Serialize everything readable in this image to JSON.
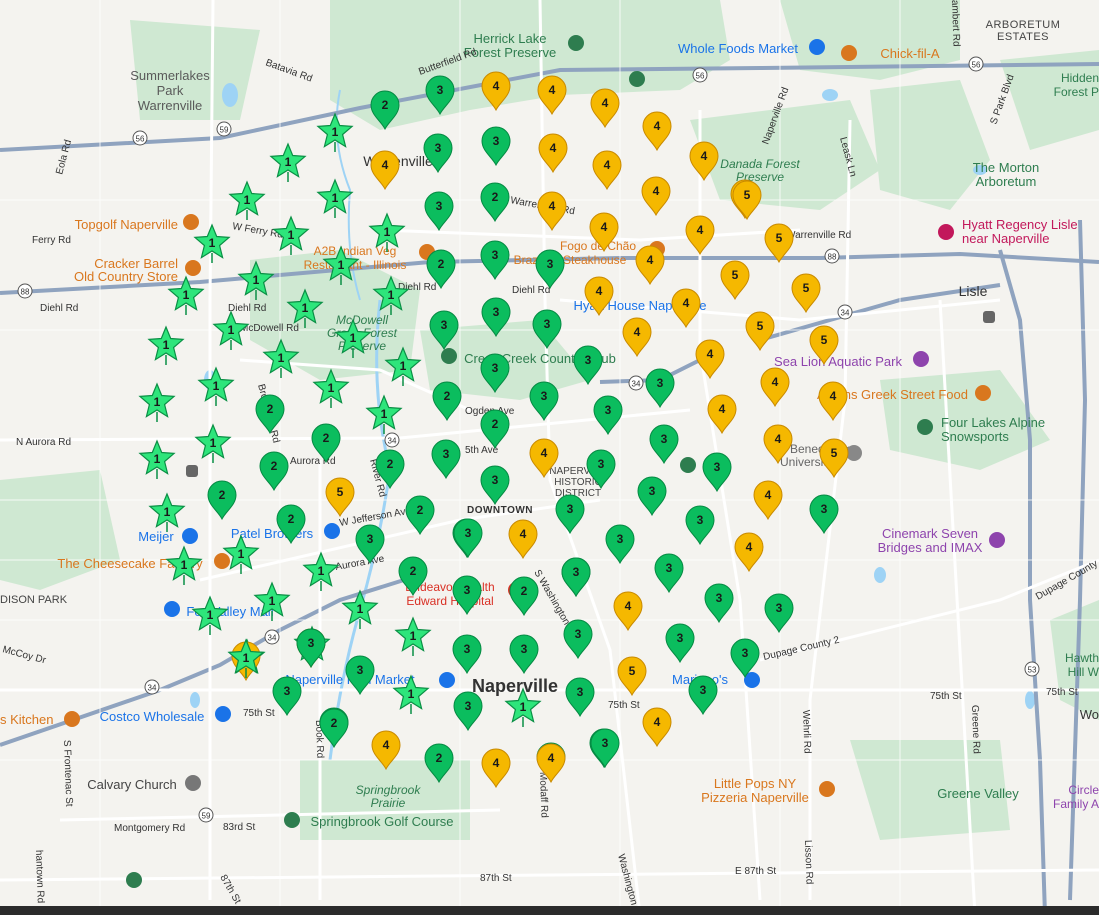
{
  "places": {
    "neighborhoods": {
      "summerlakes": "Summerlakes",
      "summerlakes_2": "Park",
      "summerlakes_3": "Warrenville",
      "arboretum": "ARBORETUM",
      "arboretum_2": "ESTATES",
      "historic": "NAPERVILLE",
      "historic_2": "HISTORIC",
      "historic_3": "DISTRICT",
      "downtown": "DOWNTOWN",
      "edison": "EDISON PARK"
    },
    "towns": {
      "naperville": "Naperville",
      "warrenville": "Warrenville",
      "lisle": "Lisle"
    },
    "pois": {
      "herrick": "Herrick Lake",
      "herrick_2": "Forest Preserve",
      "whole_foods": "Whole Foods Market",
      "chick": "Chick-fil-A",
      "hidden": "Hidden",
      "hidden_2": "Forest P",
      "danada": "Danada Forest",
      "danada_2": "Preserve",
      "morton": "The Morton",
      "morton_2": "Arboretum",
      "hyatt": "Hyatt Regency Lisle",
      "hyatt_2": "near Naperville",
      "topgolf": "Topgolf Naperville",
      "cracker": "Cracker Barrel",
      "cracker_2": "Old Country Store",
      "a2b": "A2B Indian Veg",
      "a2b_2": "Restaurant - Illinois",
      "fogo": "Fogo de Chão",
      "fogo_2": "Brazilian Steakhouse",
      "hyatt_house": "Hyatt House Naperville",
      "mcdowell": "McDowell",
      "mcdowell_2": "Grove Forest",
      "mcdowell_3": "Preserve",
      "country_club": "Cress Creek Country Club",
      "sealion": "Sea Lion Aquatic Park",
      "athens": "Athens Greek Street Food",
      "four_lakes": "Four Lakes Alpine",
      "four_lakes_2": "Snowsports",
      "benedictine": "Benedictine",
      "benedictine_2": "University",
      "meijer": "Meijer",
      "patel": "Patel Brothers",
      "cheesecake": "The Cheesecake Factory",
      "fox_valley": "Fox Valley Mall",
      "cinemark": "Cinemark Seven",
      "cinemark_2": "Bridges and IMAX",
      "edward": "Endeavor Health",
      "edward_2": "Edward Hospital",
      "fish": "Naperville Fish Market",
      "mariano": "Mariano's",
      "kitchen": "s Kitchen",
      "costco": "Costco Wholesale",
      "calvary": "Calvary Church",
      "springbrook": "Springbrook",
      "springbrook_2": "Prairie",
      "springbrook_golf": "Springbrook Golf Course",
      "little_pops": "Little Pops NY",
      "little_pops_2": "Pizzeria Naperville",
      "greene": "Greene Valley",
      "hawth": "Hawth",
      "hawth_2": "Hill W",
      "circle": "Circle",
      "circle_2": "Family A",
      "wo": "Wo"
    }
  },
  "roads": {
    "batavia": "Batavia Rd",
    "butterfield": "Butterfield Rd",
    "eola": "Eola Rd",
    "warrenville": "Warrenville Rd",
    "ferry": "Ferry Rd",
    "w_ferry": "W Ferry Rd",
    "diehl": "Diehl Rd",
    "diehl2": "Diehl Rd",
    "diehl3": "Diehl Rd",
    "mcdowell": "McDowell Rd",
    "brookdale": "Brookdale Rd",
    "n_aurora": "N Aurora Rd",
    "aurora_rd": "Aurora Rd",
    "aurora_ave": "Aurora Ave",
    "ogden": "Ogden Ave",
    "fifth": "5th Ave",
    "jefferson": "W Jefferson Ave",
    "river": "River Rd",
    "washington": "S Washington St",
    "modaff": "Modaff Rd",
    "dupage": "Dupage County 2",
    "dupage_county": "Dupage County",
    "w_75th": "75th St",
    "e_75th": "75th St",
    "e_75th_2": "75th St",
    "mccoy": "McCoy Dr",
    "montgomery": "Montgomery Rd",
    "st_83": "83rd St",
    "st_87": "87th St",
    "st_87b": "87th St",
    "e_87th": "E 87th St",
    "naperville_rd": "Naperville Rd",
    "leask": "Leask Ln",
    "park_blvd": "S Park Blvd",
    "wehrli": "Wehrli Rd",
    "lisson": "Lisson Rd",
    "greene": "Greene Rd",
    "frontenac": "S Frontenac St",
    "washington_s": "Washington St",
    "book": "Book Rd",
    "cambert": "ambert Rd",
    "hantown": "hantown Rd",
    "warrenville_e": "Warrenville Rd",
    "edison_label": "DISON PARK"
  },
  "shields": {
    "r56a": "56",
    "r56b": "56",
    "r56c": "56",
    "r59a": "59",
    "r59b": "59",
    "r88a": "88",
    "r88b": "88",
    "r34a": "34",
    "r34b": "34",
    "r34c": "34",
    "r34d": "34",
    "r34e": "34",
    "r53": "53"
  },
  "markers": [
    {
      "label": "2",
      "tier": "green",
      "kind": "pin"
    },
    {
      "label": "3",
      "tier": "green",
      "kind": "pin"
    },
    {
      "label": "4",
      "tier": "yellow",
      "kind": "pin"
    },
    {
      "label": "4",
      "tier": "yellow",
      "kind": "pin"
    },
    {
      "label": "4",
      "tier": "yellow",
      "kind": "pin"
    },
    {
      "label": "4",
      "tier": "yellow",
      "kind": "pin"
    },
    {
      "label": "1",
      "tier": "green",
      "kind": "star"
    },
    {
      "label": "1",
      "tier": "green",
      "kind": "star"
    },
    {
      "label": "3",
      "tier": "green",
      "kind": "pin"
    },
    {
      "label": "4",
      "tier": "yellow",
      "kind": "pin"
    },
    {
      "label": "3",
      "tier": "green",
      "kind": "pin"
    },
    {
      "label": "4",
      "tier": "yellow",
      "kind": "pin"
    },
    {
      "label": "4",
      "tier": "yellow",
      "kind": "pin"
    },
    {
      "label": "4",
      "tier": "yellow",
      "kind": "pin"
    },
    {
      "label": "1",
      "tier": "green",
      "kind": "star"
    },
    {
      "label": "1",
      "tier": "green",
      "kind": "star"
    },
    {
      "label": "4",
      "tier": "yellow",
      "kind": "pin"
    },
    {
      "label": "2",
      "tier": "green",
      "kind": "pin"
    },
    {
      "label": "4",
      "tier": "yellow",
      "kind": "pin"
    },
    {
      "label": "4",
      "tier": "yellow",
      "kind": "pin"
    },
    {
      "label": "5",
      "tier": "yellow",
      "kind": "pin"
    },
    {
      "label": "1",
      "tier": "green",
      "kind": "star"
    },
    {
      "label": "1",
      "tier": "green",
      "kind": "star"
    },
    {
      "label": "1",
      "tier": "green",
      "kind": "star"
    },
    {
      "label": "3",
      "tier": "green",
      "kind": "pin"
    },
    {
      "label": "4",
      "tier": "yellow",
      "kind": "pin"
    },
    {
      "label": "4",
      "tier": "yellow",
      "kind": "pin"
    },
    {
      "label": "4",
      "tier": "yellow",
      "kind": "pin"
    },
    {
      "label": "5",
      "tier": "yellow",
      "kind": "pin"
    },
    {
      "label": "1",
      "tier": "green",
      "kind": "star"
    },
    {
      "label": "1",
      "tier": "green",
      "kind": "star"
    },
    {
      "label": "1",
      "tier": "green",
      "kind": "star"
    },
    {
      "label": "2",
      "tier": "green",
      "kind": "pin"
    },
    {
      "label": "3",
      "tier": "green",
      "kind": "pin"
    },
    {
      "label": "3",
      "tier": "green",
      "kind": "pin"
    },
    {
      "label": "4",
      "tier": "yellow",
      "kind": "pin"
    },
    {
      "label": "5",
      "tier": "yellow",
      "kind": "pin"
    },
    {
      "label": "1",
      "tier": "green",
      "kind": "star"
    },
    {
      "label": "1",
      "tier": "green",
      "kind": "star"
    },
    {
      "label": "1",
      "tier": "green",
      "kind": "star"
    },
    {
      "label": "1",
      "tier": "green",
      "kind": "star"
    },
    {
      "label": "4",
      "tier": "yellow",
      "kind": "pin"
    },
    {
      "label": "4",
      "tier": "yellow",
      "kind": "pin"
    },
    {
      "label": "5",
      "tier": "yellow",
      "kind": "pin"
    },
    {
      "label": "1",
      "tier": "green",
      "kind": "star"
    },
    {
      "label": "1",
      "tier": "green",
      "kind": "star"
    },
    {
      "label": "1",
      "tier": "green",
      "kind": "star"
    },
    {
      "label": "2",
      "tier": "green",
      "kind": "pin"
    },
    {
      "label": "3",
      "tier": "green",
      "kind": "pin"
    },
    {
      "label": "3",
      "tier": "green",
      "kind": "pin"
    },
    {
      "label": "4",
      "tier": "yellow",
      "kind": "pin"
    },
    {
      "label": "4",
      "tier": "yellow",
      "kind": "pin"
    },
    {
      "label": "5",
      "tier": "yellow",
      "kind": "pin"
    },
    {
      "label": "5",
      "tier": "yellow",
      "kind": "pin"
    },
    {
      "label": "1",
      "tier": "green",
      "kind": "star"
    },
    {
      "label": "1",
      "tier": "green",
      "kind": "star"
    },
    {
      "label": "1",
      "tier": "green",
      "kind": "star"
    },
    {
      "label": "1",
      "tier": "green",
      "kind": "star"
    },
    {
      "label": "3",
      "tier": "green",
      "kind": "pin"
    },
    {
      "label": "3",
      "tier": "green",
      "kind": "pin"
    },
    {
      "label": "4",
      "tier": "yellow",
      "kind": "pin"
    },
    {
      "label": "1",
      "tier": "green",
      "kind": "star"
    },
    {
      "label": "1",
      "tier": "green",
      "kind": "star"
    },
    {
      "label": "1",
      "tier": "green",
      "kind": "star"
    },
    {
      "label": "1",
      "tier": "green",
      "kind": "star"
    },
    {
      "label": "2",
      "tier": "green",
      "kind": "pin"
    },
    {
      "label": "2",
      "tier": "green",
      "kind": "pin"
    },
    {
      "label": "3",
      "tier": "green",
      "kind": "pin"
    },
    {
      "label": "3",
      "tier": "green",
      "kind": "pin"
    },
    {
      "label": "3",
      "tier": "green",
      "kind": "pin"
    },
    {
      "label": "4",
      "tier": "yellow",
      "kind": "pin"
    },
    {
      "label": "4",
      "tier": "yellow",
      "kind": "pin"
    },
    {
      "label": "1",
      "tier": "green",
      "kind": "star"
    },
    {
      "label": "1",
      "tier": "green",
      "kind": "star"
    },
    {
      "label": "1",
      "tier": "green",
      "kind": "star"
    },
    {
      "label": "2",
      "tier": "green",
      "kind": "pin"
    },
    {
      "label": "2",
      "tier": "green",
      "kind": "pin"
    },
    {
      "label": "2",
      "tier": "green",
      "kind": "pin"
    },
    {
      "label": "2",
      "tier": "green",
      "kind": "pin"
    },
    {
      "label": "3",
      "tier": "green",
      "kind": "pin"
    },
    {
      "label": "3",
      "tier": "green",
      "kind": "pin"
    },
    {
      "label": "3",
      "tier": "green",
      "kind": "pin"
    },
    {
      "label": "4",
      "tier": "yellow",
      "kind": "pin"
    },
    {
      "label": "4",
      "tier": "yellow",
      "kind": "pin"
    },
    {
      "label": "5",
      "tier": "yellow",
      "kind": "pin"
    },
    {
      "label": "2",
      "tier": "green",
      "kind": "pin"
    },
    {
      "label": "2",
      "tier": "green",
      "kind": "pin"
    },
    {
      "label": "3",
      "tier": "green",
      "kind": "pin"
    },
    {
      "label": "3",
      "tier": "green",
      "kind": "pin"
    },
    {
      "label": "3",
      "tier": "green",
      "kind": "pin"
    },
    {
      "label": "3",
      "tier": "green",
      "kind": "pin"
    },
    {
      "label": "3",
      "tier": "green",
      "kind": "pin"
    },
    {
      "label": "3",
      "tier": "green",
      "kind": "pin"
    },
    {
      "label": "4",
      "tier": "yellow",
      "kind": "pin"
    },
    {
      "label": "5",
      "tier": "yellow",
      "kind": "pin"
    },
    {
      "label": "5",
      "tier": "yellow",
      "kind": "pin"
    },
    {
      "label": "1",
      "tier": "green",
      "kind": "star"
    },
    {
      "label": "1",
      "tier": "green",
      "kind": "star"
    },
    {
      "label": "1",
      "tier": "green",
      "kind": "star"
    },
    {
      "label": "2",
      "tier": "green",
      "kind": "pin"
    },
    {
      "label": "3",
      "tier": "green",
      "kind": "pin"
    },
    {
      "label": "3",
      "tier": "green",
      "kind": "pin"
    },
    {
      "label": "4",
      "tier": "yellow",
      "kind": "pin"
    },
    {
      "label": "3",
      "tier": "green",
      "kind": "pin"
    },
    {
      "label": "3",
      "tier": "green",
      "kind": "pin"
    },
    {
      "label": "3",
      "tier": "green",
      "kind": "pin"
    },
    {
      "label": "5",
      "tier": "yellow",
      "kind": "pin"
    },
    {
      "label": "1",
      "tier": "green",
      "kind": "star"
    },
    {
      "label": "2",
      "tier": "green",
      "kind": "pin"
    },
    {
      "label": "3",
      "tier": "green",
      "kind": "pin"
    },
    {
      "label": "2",
      "tier": "green",
      "kind": "pin"
    },
    {
      "label": "4",
      "tier": "yellow",
      "kind": "pin"
    },
    {
      "label": "3",
      "tier": "green",
      "kind": "pin"
    },
    {
      "label": "3",
      "tier": "green",
      "kind": "pin"
    },
    {
      "label": "3",
      "tier": "green",
      "kind": "pin"
    },
    {
      "label": "1",
      "tier": "green",
      "kind": "star"
    },
    {
      "label": "1",
      "tier": "green",
      "kind": "star"
    },
    {
      "label": "3",
      "tier": "green",
      "kind": "pin"
    },
    {
      "label": "3",
      "tier": "green",
      "kind": "pin"
    },
    {
      "label": "3",
      "tier": "green",
      "kind": "pin"
    },
    {
      "label": "3",
      "tier": "green",
      "kind": "pin"
    },
    {
      "label": "3",
      "tier": "green",
      "kind": "pin"
    },
    {
      "label": "3",
      "tier": "green",
      "kind": "pin"
    },
    {
      "label": "3",
      "tier": "green",
      "kind": "pin"
    },
    {
      "label": "3",
      "tier": "green",
      "kind": "pin"
    },
    {
      "label": "1",
      "tier": "green",
      "kind": "star"
    },
    {
      "label": "1",
      "tier": "green",
      "kind": "star"
    },
    {
      "label": "3",
      "tier": "green",
      "kind": "pin"
    },
    {
      "label": "3",
      "tier": "green",
      "kind": "pin"
    },
    {
      "label": "5",
      "tier": "yellow",
      "kind": "pin"
    },
    {
      "label": "3",
      "tier": "green",
      "kind": "pin"
    },
    {
      "label": "2",
      "tier": "green",
      "kind": "pin"
    },
    {
      "label": "3",
      "tier": "green",
      "kind": "pin"
    },
    {
      "label": "4",
      "tier": "yellow",
      "kind": "pin"
    },
    {
      "label": "3",
      "tier": "green",
      "kind": "pin"
    },
    {
      "label": "3",
      "tier": "green",
      "kind": "pin"
    },
    {
      "label": "4",
      "tier": "yellow",
      "kind": "pin"
    },
    {
      "label": "2",
      "tier": "green",
      "kind": "pin"
    },
    {
      "label": "2",
      "tier": "green",
      "kind": "pin"
    },
    {
      "label": "4",
      "tier": "yellow",
      "kind": "pin"
    },
    {
      "label": "4",
      "tier": "yellow",
      "kind": "pin"
    },
    {
      "label": "3",
      "tier": "green",
      "kind": "pin"
    },
    {
      "label": "4",
      "tier": "yellow",
      "kind": "pin"
    }
  ],
  "colors": {
    "green_pin": "#0bbd5e",
    "green_pin_stroke": "#058a43",
    "star": "#2ee57b",
    "star_stroke": "#0a8f45",
    "yellow_pin": "#f5b800",
    "yellow_pin_stroke": "#c98a00",
    "park": "#cfe8d2",
    "water": "#9ed3f5",
    "highway": "#8fa3bf",
    "road": "#ffffff"
  }
}
